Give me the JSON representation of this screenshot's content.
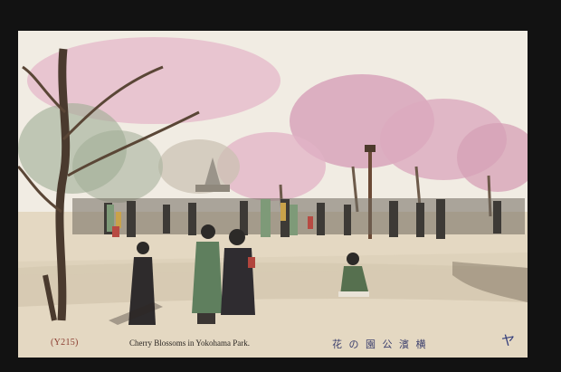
{
  "postcard": {
    "code": "(Y215)",
    "title_en": "Cherry Blossoms in Yokohama Park.",
    "title_jp": "花 の 園 公 濱 横",
    "publisher_mark": "ヤ"
  },
  "colors": {
    "sky": "#f2ede4",
    "blossom": "#d9a0b8",
    "ground": "#e2d6c0",
    "border": "#121212",
    "ink": "#3b3f6d"
  }
}
